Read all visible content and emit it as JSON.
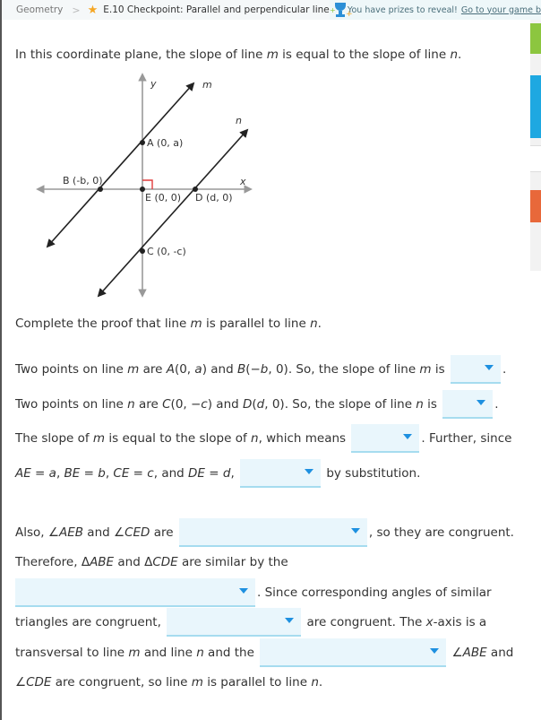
{
  "breadcrumb": {
    "subject": "Geometry",
    "separator": ">",
    "skill": "E.10 Checkpoint: Parallel and perpendicular lines"
  },
  "prize_banner": {
    "text": "You have prizes to reveal!",
    "link": "Go to your game b"
  },
  "question": {
    "intro": [
      "In this coordinate plane, the slope of line ",
      "m",
      " is equal to the slope of line ",
      "n",
      "."
    ],
    "prompt": [
      "Complete the proof that line ",
      "m",
      " is parallel to line ",
      "n",
      "."
    ]
  },
  "diagram": {
    "y_axis_label": "y",
    "x_axis_label": "x",
    "line_m_label": "m",
    "line_n_label": "n",
    "points": {
      "A": "A (0, a)",
      "B": "B (-b, 0)",
      "E": "E (0, 0)",
      "D": "D (d, 0)",
      "C": "C (0, -c)"
    },
    "right_angle_color": "#e03c3c"
  },
  "proof": {
    "s1": {
      "a": "Two points on line ",
      "m": "m",
      "b": " are ",
      "A": "A",
      "c": "(0, ",
      "av": "a",
      "d": ") and ",
      "B": "B",
      "e": "(−",
      "bv": "b",
      "f": ", 0). So, the slope of line ",
      "m2": "m",
      "g": " is ",
      "end": "."
    },
    "s2": {
      "a": "Two points on line ",
      "n": "n",
      "b": " are ",
      "C": "C",
      "c": "(0, −",
      "cv": "c",
      "d": ") and ",
      "D": "D",
      "e": "(",
      "dv": "d",
      "f": ", 0). So, the slope of line ",
      "n2": "n",
      "g": " is ",
      "end": "."
    },
    "s3": {
      "a": "The slope of ",
      "m": "m",
      "b": " is equal to the slope of ",
      "n": "n",
      "c": ", which means ",
      "end": ". Further, since"
    },
    "s4": {
      "ae": "AE",
      "eq1": " = ",
      "a": "a",
      "c1": ", ",
      "be": "BE",
      "eq2": " = ",
      "b": "b",
      "c2": ", ",
      "ce": "CE",
      "eq3": " = ",
      "c": "c",
      "c3": ", and ",
      "de": "DE",
      "eq4": " = ",
      "d": "d",
      "c4": ",",
      "end": " by substitution."
    },
    "s5": {
      "a": "Also, ∠",
      "aeb": "AEB",
      "b": " and ∠",
      "ced": "CED",
      "c": " are ",
      "end": ", so they are congruent."
    },
    "s6": {
      "a": "Therefore, Δ",
      "abe": "ABE",
      "b": " and Δ",
      "cde": "CDE",
      "c": " are similar by the"
    },
    "s7": {
      "end": ". Since corresponding angles of similar"
    },
    "s8": {
      "a": "triangles are congruent, ",
      "b": " are congruent. The ",
      "x": "x",
      "c": "-axis is a"
    },
    "s9": {
      "a": "transversal to line ",
      "m": "m",
      "b": " and line ",
      "n": "n",
      "c": " and the ",
      "d": " ∠",
      "abe": "ABE",
      "e": " and"
    },
    "s10": {
      "a": "∠",
      "cde": "CDE",
      "b": " are congruent, so line ",
      "m": "m",
      "c": " is parallel to line ",
      "n": "n",
      "end": "."
    }
  },
  "dropdowns": {
    "slope_m": "",
    "slope_n": "",
    "which_means": "",
    "substitution": "",
    "angle_type": "",
    "similarity_criterion": "",
    "congruent_angles": "",
    "angle_relationship": ""
  },
  "colors": {
    "dropdown_bg": "#e9f6fc",
    "dropdown_arrow": "#1e90e0",
    "side_green": "#8cc63f",
    "side_blue": "#1ea8e1",
    "side_orange": "#e8683a"
  }
}
